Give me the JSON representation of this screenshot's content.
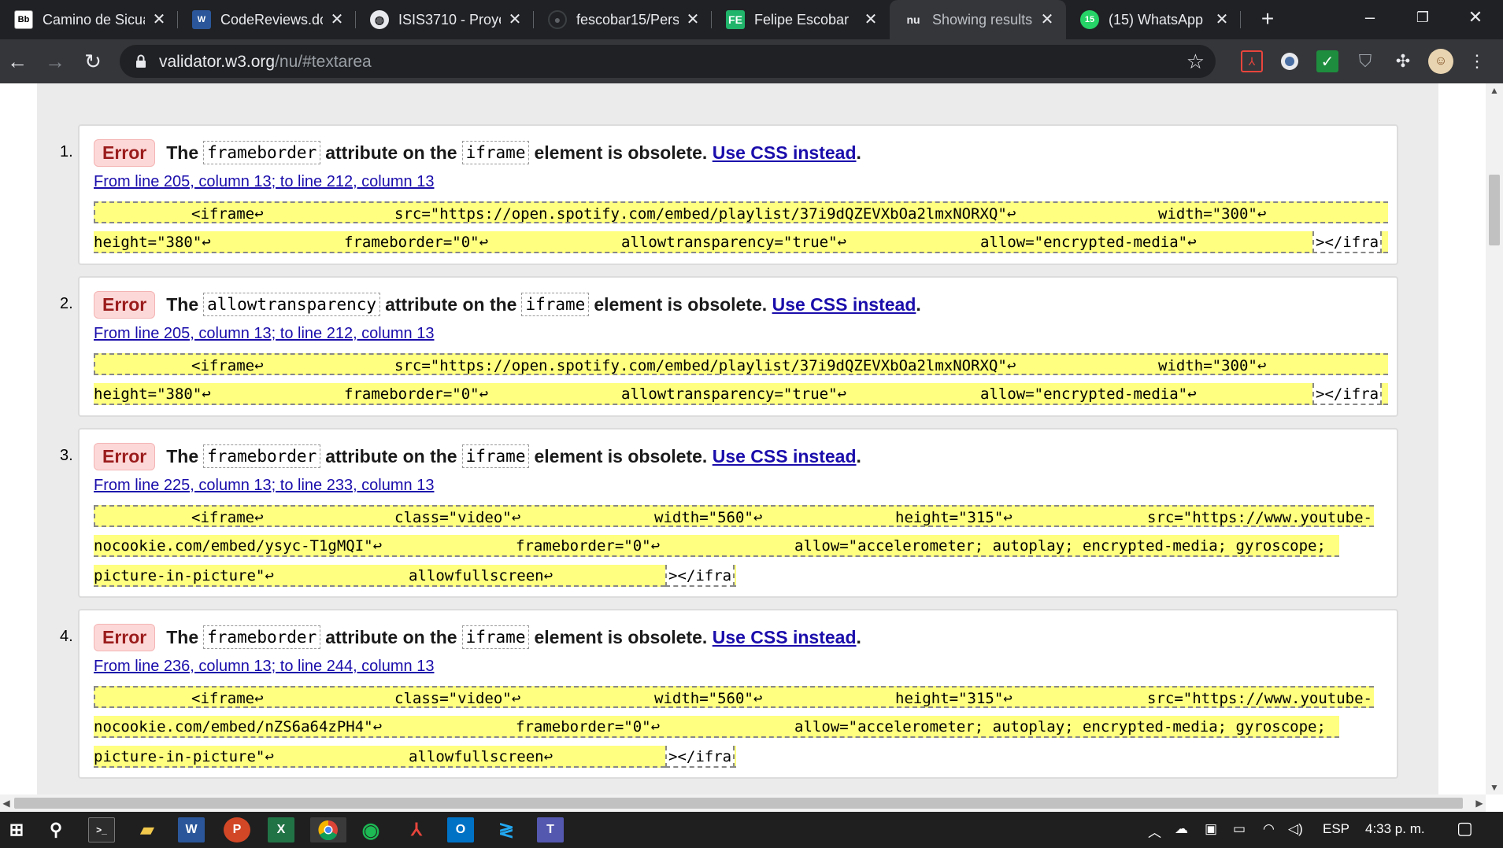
{
  "tabs": [
    {
      "title": "Camino de Sicua",
      "favicon": "blackboard-icon",
      "favicon_text": "Bb",
      "favicon_color": "#262626"
    },
    {
      "title": "CodeReviews.do",
      "favicon": "word-icon",
      "favicon_text": "W",
      "favicon_color": "#2b579a"
    },
    {
      "title": "ISIS3710 - Proye",
      "favicon": "globe-icon",
      "favicon_text": "🌐",
      "favicon_color": "#202124"
    },
    {
      "title": "fescobar15/Pers",
      "favicon": "github-icon",
      "favicon_text": "●",
      "favicon_color": "#202124"
    },
    {
      "title": "Felipe Escobar",
      "favicon": "fe-icon",
      "favicon_text": "FE",
      "favicon_color": "#20b46b"
    },
    {
      "title": "Showing results",
      "favicon": "nu-icon",
      "favicon_text": "nu",
      "favicon_color": "#35363a"
    },
    {
      "title": "(15) WhatsApp",
      "favicon": "whatsapp-icon",
      "favicon_text": "15",
      "favicon_color": "#25d366"
    }
  ],
  "address_bar": {
    "host": "validator.w3.org",
    "path": "/nu/#textarea"
  },
  "messages": [
    {
      "num": "1.",
      "type": "Error",
      "pre": "The",
      "attr": "frameborder",
      "mid": "attribute on the",
      "el": "iframe",
      "post": "element is obsolete.",
      "link": "Use CSS instead",
      "tail": ".",
      "location": "From line 205, column 13; to line 212, column 13",
      "extract_lines": [
        [
          "<iframe↩",
          "src=\"https://open.spotify.com/embed/playlist/37i9dQZEVXbOa2lmxNORXQ\"↩",
          "width=\"300\"↩"
        ],
        [
          "height=\"380\"↩",
          "frameborder=\"0\"↩",
          "allowtransparency=\"true\"↩",
          "allow=\"encrypted-media\"↩",
          "></ifra"
        ]
      ]
    },
    {
      "num": "2.",
      "type": "Error",
      "pre": "The",
      "attr": "allowtransparency",
      "mid": "attribute on the",
      "el": "iframe",
      "post": "element is obsolete.",
      "link": "Use CSS instead",
      "tail": ".",
      "location": "From line 205, column 13; to line 212, column 13",
      "extract_lines": [
        [
          "<iframe↩",
          "src=\"https://open.spotify.com/embed/playlist/37i9dQZEVXbOa2lmxNORXQ\"↩",
          "width=\"300\"↩"
        ],
        [
          "height=\"380\"↩",
          "frameborder=\"0\"↩",
          "allowtransparency=\"true\"↩",
          "allow=\"encrypted-media\"↩",
          "></ifra"
        ]
      ]
    },
    {
      "num": "3.",
      "type": "Error",
      "pre": "The",
      "attr": "frameborder",
      "mid": "attribute on the",
      "el": "iframe",
      "post": "element is obsolete.",
      "link": "Use CSS instead",
      "tail": ".",
      "location": "From line 225, column 13; to line 233, column 13",
      "extract_lines": [
        [
          "<iframe↩",
          "class=\"video\"↩",
          "width=\"560\"↩",
          "height=\"315\"↩",
          "src=\"https://www.youtube-"
        ],
        [
          "nocookie.com/embed/ysyc-T1gMQI\"↩",
          "frameborder=\"0\"↩",
          "allow=\"accelerometer; autoplay; encrypted-media; gyroscope;"
        ],
        [
          "picture-in-picture\"↩",
          "allowfullscreen↩",
          "></ifra"
        ]
      ]
    },
    {
      "num": "4.",
      "type": "Error",
      "pre": "The",
      "attr": "frameborder",
      "mid": "attribute on the",
      "el": "iframe",
      "post": "element is obsolete.",
      "link": "Use CSS instead",
      "tail": ".",
      "location": "From line 236, column 13; to line 244, column 13",
      "extract_lines": [
        [
          "<iframe↩",
          "class=\"video\"↩",
          "width=\"560\"↩",
          "height=\"315\"↩",
          "src=\"https://www.youtube-"
        ],
        [
          "nocookie.com/embed/nZS6a64zPH4\"↩",
          "frameborder=\"0\"↩",
          "allow=\"accelerometer; autoplay; encrypted-media; gyroscope;"
        ],
        [
          "picture-in-picture\"↩",
          "allowfullscreen↩",
          "></ifra"
        ]
      ]
    }
  ],
  "taskbar": {
    "language": "ESP",
    "time": "4:33 p. m."
  },
  "colors": {
    "error_badge_bg": "#fdd8d8",
    "highlight": "#ffff80",
    "link": "#1a0dab"
  }
}
